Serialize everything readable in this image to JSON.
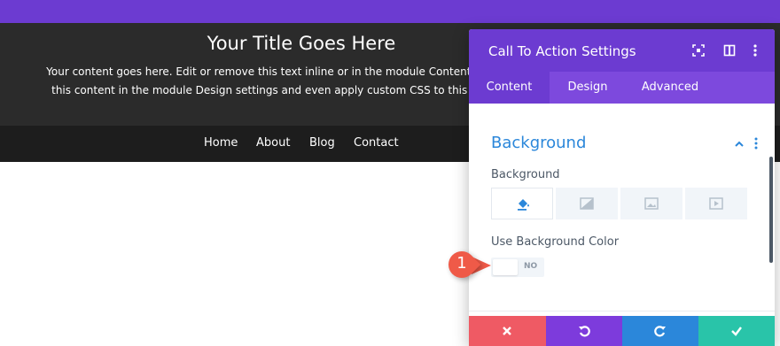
{
  "page": {
    "cta_title": "Your Title Goes Here",
    "cta_body_line1": "Your content goes here. Edit or remove this text inline or in the module Content settings. You c",
    "cta_body_line2": "this content in the module Design settings and even apply custom CSS to this text in the mo"
  },
  "menu": {
    "items": [
      {
        "label": "Home"
      },
      {
        "label": "About"
      },
      {
        "label": "Blog"
      },
      {
        "label": "Contact"
      }
    ]
  },
  "panel": {
    "title": "Call To Action Settings",
    "header_icons": [
      "fullscreen-icon",
      "sidebar-layout-icon",
      "more-options-icon"
    ],
    "tabs": [
      {
        "label": "Content",
        "active": true
      },
      {
        "label": "Design",
        "active": false
      },
      {
        "label": "Advanced",
        "active": false
      }
    ],
    "section": {
      "title": "Background",
      "background_label": "Background",
      "background_types": [
        {
          "icon": "paint-bucket-icon",
          "active": true
        },
        {
          "icon": "gradient-icon",
          "active": false
        },
        {
          "icon": "image-icon",
          "active": false
        },
        {
          "icon": "video-icon",
          "active": false
        }
      ],
      "use_bg_color_label": "Use Background Color",
      "toggle_value": "NO"
    },
    "footer": {
      "buttons": [
        {
          "name": "discard",
          "icon": "close-icon"
        },
        {
          "name": "undo",
          "icon": "undo-icon"
        },
        {
          "name": "redo",
          "icon": "redo-icon"
        },
        {
          "name": "save",
          "icon": "check-icon"
        }
      ]
    }
  },
  "annotation": {
    "badge": "1"
  },
  "colors": {
    "purple_header": "#6c3bd1",
    "purple_tabs": "#7d49dd",
    "blue_title": "#2b87da",
    "footer_red": "#ef5a64",
    "footer_purple": "#7d3bdc",
    "footer_blue": "#2b87da",
    "footer_green": "#29c4a9",
    "badge_red": "#ef5a48"
  }
}
